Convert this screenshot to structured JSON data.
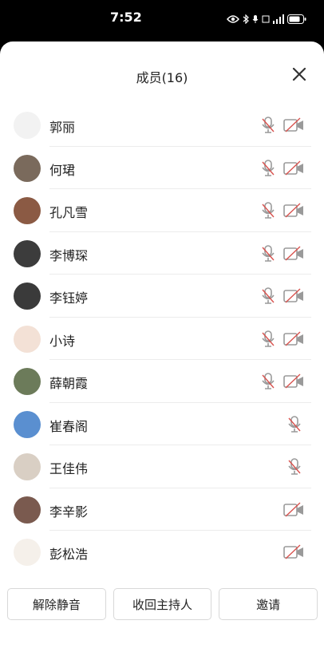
{
  "status_bar": {
    "time": "7:52",
    "icons": [
      "eye-icon",
      "bluetooth-icon",
      "mic-icon",
      "5g-icon",
      "signal-icon",
      "battery-icon"
    ]
  },
  "panel": {
    "title": "成员(16)",
    "close_icon": "close-icon"
  },
  "members": [
    {
      "name": "郭丽",
      "mic_muted": true,
      "camera_off": true,
      "avatar_color": "#f2f2f2"
    },
    {
      "name": "何珺",
      "mic_muted": true,
      "camera_off": true,
      "avatar_color": "#7a6a5c"
    },
    {
      "name": "孔凡雪",
      "mic_muted": true,
      "camera_off": true,
      "avatar_color": "#8b5a44"
    },
    {
      "name": "李博琛",
      "mic_muted": true,
      "camera_off": true,
      "avatar_color": "#3c3c3c"
    },
    {
      "name": "李钰婷",
      "mic_muted": true,
      "camera_off": true,
      "avatar_color": "#3a3a3a"
    },
    {
      "name": "小诗",
      "mic_muted": true,
      "camera_off": true,
      "avatar_color": "#f3e1d6"
    },
    {
      "name": "薛朝霞",
      "mic_muted": true,
      "camera_off": true,
      "avatar_color": "#6c7b5a"
    },
    {
      "name": "崔春阁",
      "mic_muted": true,
      "camera_off": false,
      "avatar_color": "#5a8fd0"
    },
    {
      "name": "王佳伟",
      "mic_muted": true,
      "camera_off": false,
      "avatar_color": "#d9cfc4"
    },
    {
      "name": "李辛影",
      "mic_muted": false,
      "camera_off": true,
      "avatar_color": "#7a5a4f"
    },
    {
      "name": "彭松浩",
      "mic_muted": false,
      "camera_off": true,
      "avatar_color": "#f5f0ea"
    }
  ],
  "footer": {
    "unmute_all_label": "解除静音",
    "reclaim_host_label": "收回主持人",
    "invite_label": "邀请"
  },
  "colors": {
    "icon_gray": "#9a9a9a",
    "slash_red": "#d9534f"
  }
}
